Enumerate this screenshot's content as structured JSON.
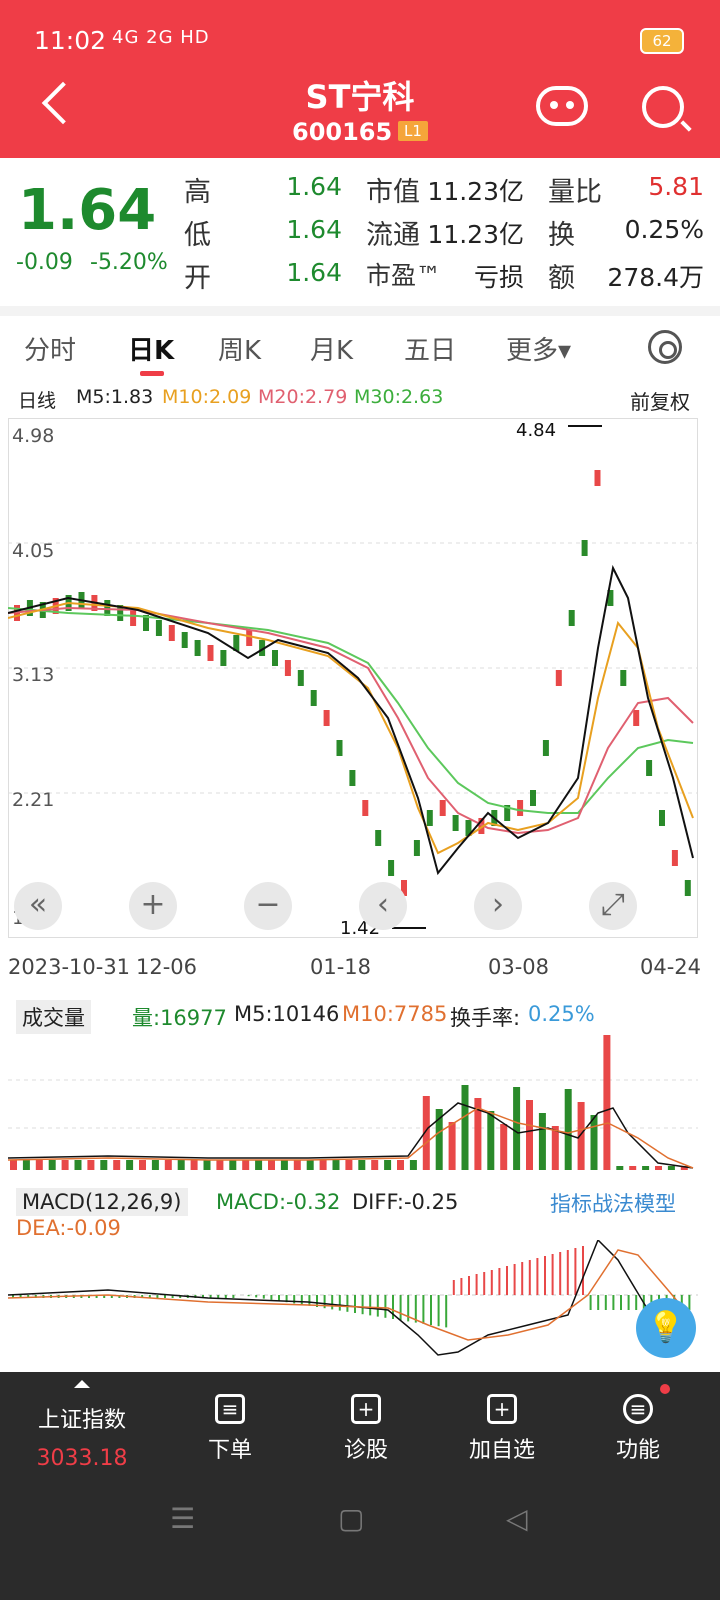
{
  "status_bar": {
    "time": "11:02",
    "signal": "4G 2G HD",
    "battery": "62"
  },
  "header": {
    "title": "ST宁科",
    "code": "600165",
    "level": "L1"
  },
  "quote": {
    "price": "1.64",
    "change": "-0.09",
    "change_pct": "-5.20%",
    "rows": [
      {
        "l1": "高",
        "v1": "1.64",
        "l2": "市值",
        "v2": "11.23亿",
        "l3": "量比",
        "v3": "5.81"
      },
      {
        "l1": "低",
        "v1": "1.64",
        "l2": "流通",
        "v2": "11.23亿",
        "l3": "换",
        "v3": "0.25%"
      },
      {
        "l1": "开",
        "v1": "1.64",
        "l2": "市盈™",
        "v2": "亏损",
        "l3": "额",
        "v3": "278.4万"
      }
    ]
  },
  "tabs": [
    "分时",
    "日K",
    "周K",
    "月K",
    "五日",
    "更多▾"
  ],
  "kline": {
    "period": "日线",
    "ma5": "M5:1.83",
    "ma10": "M10:2.09",
    "ma20": "M20:2.79",
    "ma30": "M30:2.63",
    "adjust": "前复权",
    "y_labels": [
      "4.98",
      "4.05",
      "3.13",
      "2.21",
      "1.28"
    ],
    "high_mark": "4.84",
    "low_mark": "1.42",
    "dates": [
      "2023-10-31",
      "12-06",
      "01-18",
      "03-08",
      "04-24"
    ],
    "controls": [
      "«",
      "+",
      "−",
      "‹",
      "›",
      "⤢"
    ]
  },
  "volume": {
    "label": "成交量",
    "vol": "量:16977",
    "m5": "M5:10146",
    "m10": "M10:7785",
    "turnover_label": "换手率:",
    "turnover": "0.25%"
  },
  "macd": {
    "label": "MACD(12,26,9)",
    "macd": "MACD:-0.32",
    "diff": "DIFF:-0.25",
    "dea": "DEA:-0.09",
    "model": "指标战法模型"
  },
  "bottom_nav": {
    "index_name": "上证指数",
    "index_value": "3033.18",
    "items": [
      "下单",
      "诊股",
      "加自选",
      "功能"
    ]
  },
  "colors": {
    "red": "#ef3d47",
    "green": "#1e8a2e",
    "orange": "#e8a020",
    "pink": "#e06070",
    "bright_green": "#5cc85c"
  }
}
